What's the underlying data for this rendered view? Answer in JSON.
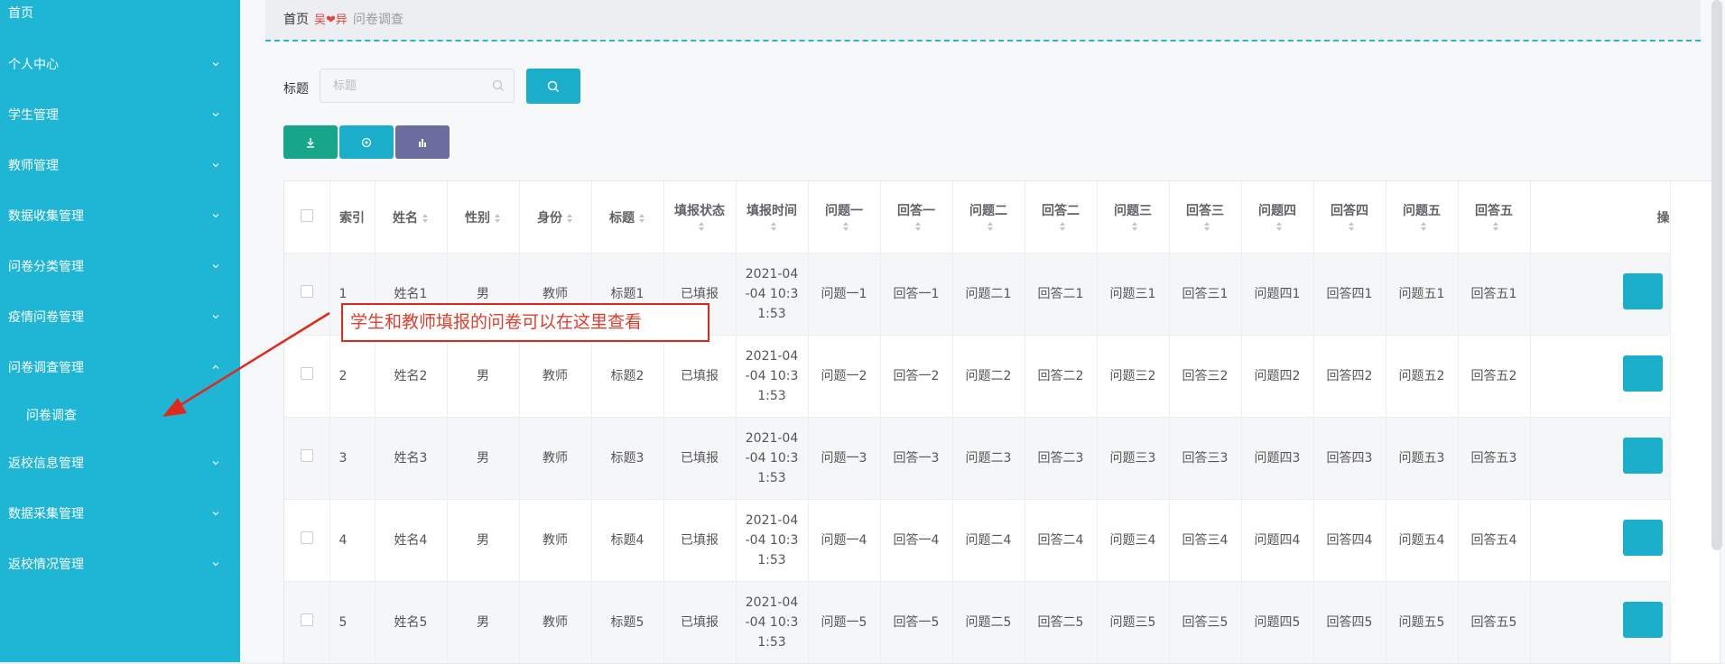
{
  "sidebar": {
    "home": "首页",
    "items": [
      {
        "label": "个人中心"
      },
      {
        "label": "学生管理"
      },
      {
        "label": "教师管理"
      },
      {
        "label": "数据收集管理"
      },
      {
        "label": "问卷分类管理"
      },
      {
        "label": "疫情问卷管理"
      },
      {
        "label": "问卷调查管理"
      },
      {
        "label": "返校信息管理"
      },
      {
        "label": "数据采集管理"
      },
      {
        "label": "返校情况管理"
      }
    ],
    "active_sub": "问卷调查"
  },
  "breadcrumb": {
    "home": "首页",
    "separator": "吴❤异",
    "current": "问卷调查"
  },
  "search": {
    "label": "标题",
    "placeholder": "标题"
  },
  "table": {
    "headers": [
      "索引",
      "姓名",
      "性别",
      "身份",
      "标题",
      "填报状态",
      "填报时间",
      "问题一",
      "回答一",
      "问题二",
      "回答二",
      "问题三",
      "回答三",
      "问题四",
      "回答四",
      "问题五",
      "回答五",
      "操"
    ],
    "rows": [
      [
        "1",
        "姓名1",
        "男",
        "教师",
        "标题1",
        "已填报",
        "2021-04 -04 10:3 1:53",
        "问题一1",
        "回答一1",
        "问题二1",
        "回答二1",
        "问题三1",
        "回答三1",
        "问题四1",
        "回答四1",
        "问题五1",
        "回答五1"
      ],
      [
        "2",
        "姓名2",
        "男",
        "教师",
        "标题2",
        "已填报",
        "2021-04 -04 10:3 1:53",
        "问题一2",
        "回答一2",
        "问题二2",
        "回答二2",
        "问题三2",
        "回答三2",
        "问题四2",
        "回答四2",
        "问题五2",
        "回答五2"
      ],
      [
        "3",
        "姓名3",
        "男",
        "教师",
        "标题3",
        "已填报",
        "2021-04 -04 10:3 1:53",
        "问题一3",
        "回答一3",
        "问题二3",
        "回答二3",
        "问题三3",
        "回答三3",
        "问题四3",
        "回答四3",
        "问题五3",
        "回答五3"
      ],
      [
        "4",
        "姓名4",
        "男",
        "教师",
        "标题4",
        "已填报",
        "2021-04 -04 10:3 1:53",
        "问题一4",
        "回答一4",
        "问题二4",
        "回答二4",
        "问题三4",
        "回答三4",
        "问题四4",
        "回答四4",
        "问题五4",
        "回答五4"
      ],
      [
        "5",
        "姓名5",
        "男",
        "教师",
        "标题5",
        "已填报",
        "2021-04 -04 10:3 1:53",
        "问题一5",
        "回答一5",
        "问题二5",
        "回答二5",
        "问题三5",
        "回答三5",
        "问题四5",
        "回答四5",
        "问题五5",
        "回答五5"
      ]
    ]
  },
  "annotation": {
    "text": "学生和教师填报的问卷可以在这里查看"
  },
  "colors": {
    "sidebar": "#1fb5d4",
    "primary": "#1aaecb",
    "export": "#17a68a",
    "stats": "#6a6d9e",
    "annotation": "#e0281c"
  }
}
